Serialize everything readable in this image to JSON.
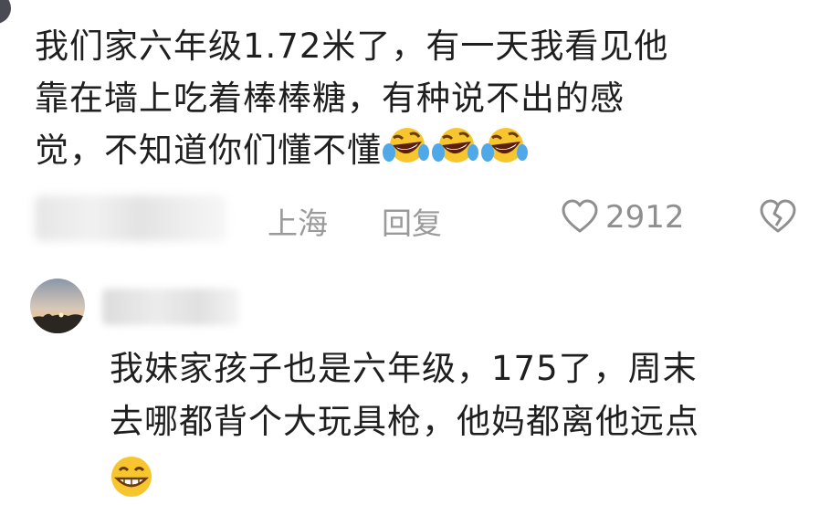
{
  "comment1": {
    "lines": [
      "我们家六年级1.72米了，有一天我看见他",
      "靠在墙上吃着棒棒糖，有种说不出的感",
      "觉，不知道你们懂不懂"
    ],
    "emojis": [
      "laugh-cry-emoji",
      "laugh-cry-emoji",
      "laugh-cry-emoji"
    ],
    "location": "上海",
    "reply_label": "回复",
    "like_count": "2912",
    "icons": {
      "like": "heart-outline-icon",
      "dislike": "broken-heart-icon"
    }
  },
  "comment2": {
    "lines": [
      "我妹家孩子也是六年级，175了，周末",
      "去哪都背个大玩具枪，他妈都离他远点"
    ],
    "emojis": [
      "grin-emoji"
    ]
  },
  "colors": {
    "text": "#1f1f1f",
    "meta": "#9a9a9a",
    "emoji": "#f7c62f"
  }
}
